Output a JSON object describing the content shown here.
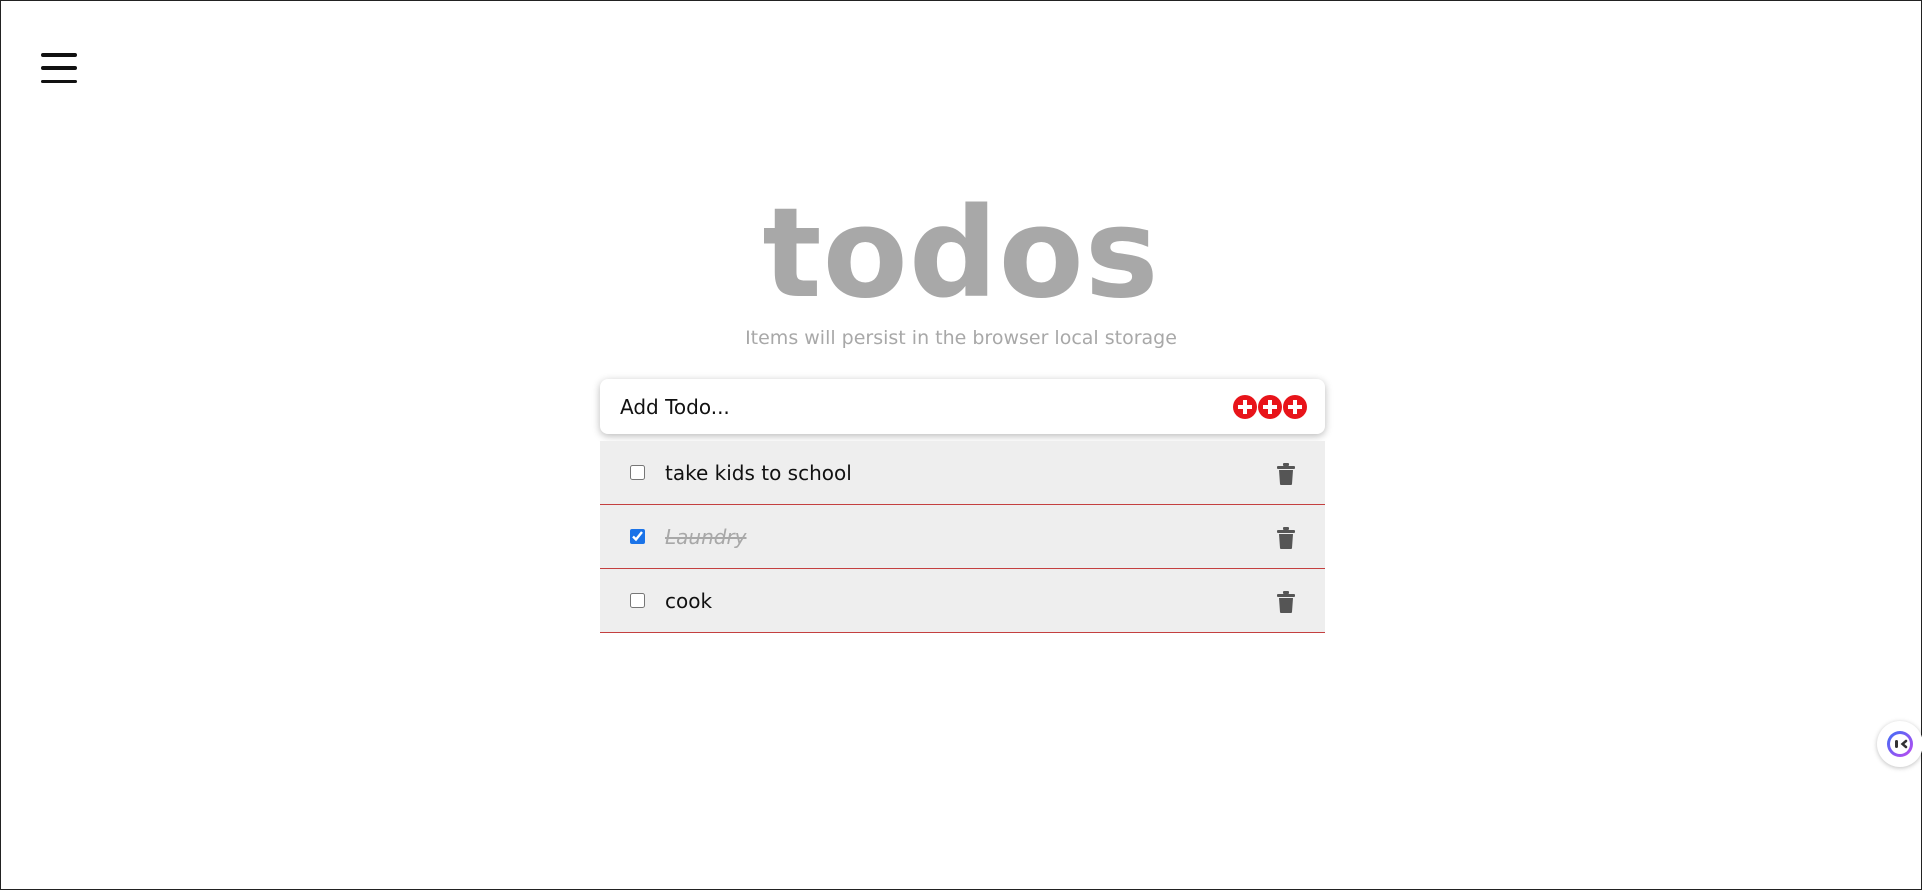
{
  "header": {
    "menu_icon": "hamburger-menu-icon"
  },
  "app": {
    "title": "todos",
    "subtitle": "Items will persist in the browser local storage"
  },
  "add_todo": {
    "placeholder": "Add Todo...",
    "value": "",
    "add_icon": "plus-circle-icon",
    "add_icon_count": 3,
    "accent_color": "#e8141a"
  },
  "todos": [
    {
      "text": "take kids to school",
      "completed": false
    },
    {
      "text": "Laundry",
      "completed": true
    },
    {
      "text": "cook",
      "completed": false
    }
  ],
  "item_icon": "trash-icon",
  "colors": {
    "title": "#a8a8a8",
    "item_background": "#eeeeee",
    "item_divider": "#c44040",
    "checkbox_checked": "#1a73e8"
  },
  "floating_widget": {
    "icon": "assistant-face-icon"
  }
}
